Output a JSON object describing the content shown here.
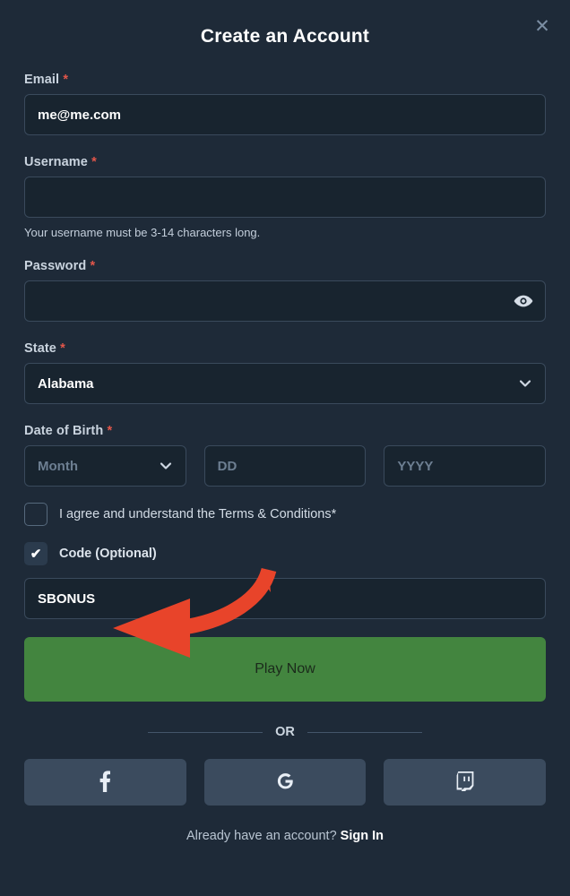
{
  "header": {
    "title": "Create an Account",
    "close_icon": "close-icon"
  },
  "fields": {
    "email": {
      "label": "Email",
      "required_marker": "*",
      "value": "me@me.com"
    },
    "username": {
      "label": "Username",
      "required_marker": "*",
      "value": "",
      "helper": "Your username must be 3-14 characters long."
    },
    "password": {
      "label": "Password",
      "required_marker": "*",
      "value": "",
      "toggle_icon": "eye-icon"
    },
    "state": {
      "label": "State",
      "required_marker": "*",
      "selected": "Alabama",
      "chevron_icon": "chevron-down-icon"
    },
    "dob": {
      "label": "Date of Birth",
      "required_marker": "*",
      "month_placeholder": "Month",
      "day_placeholder": "DD",
      "year_placeholder": "YYYY",
      "chevron_icon": "chevron-down-icon"
    },
    "code": {
      "label": "Code (Optional)",
      "checked": true,
      "value": "SBONUS"
    }
  },
  "terms": {
    "label": "I agree and understand the Terms & Conditions*",
    "checked": false
  },
  "actions": {
    "play_now": "Play Now",
    "or": "OR"
  },
  "social": [
    {
      "name": "facebook",
      "icon": "facebook-icon"
    },
    {
      "name": "google",
      "icon": "google-icon"
    },
    {
      "name": "twitch",
      "icon": "twitch-icon"
    }
  ],
  "footer": {
    "prompt": "Already have an account?",
    "link": "Sign In"
  },
  "annotation": {
    "type": "curved-arrow",
    "color": "#e8442a",
    "points_to": "code-input"
  },
  "colors": {
    "background": "#1e2a38",
    "input_background": "#18242f",
    "input_border": "#3a4a5c",
    "primary_button": "#43853f",
    "social_button": "#3b4b5e",
    "required_marker": "#e2564a",
    "annotation_arrow": "#e8442a"
  }
}
